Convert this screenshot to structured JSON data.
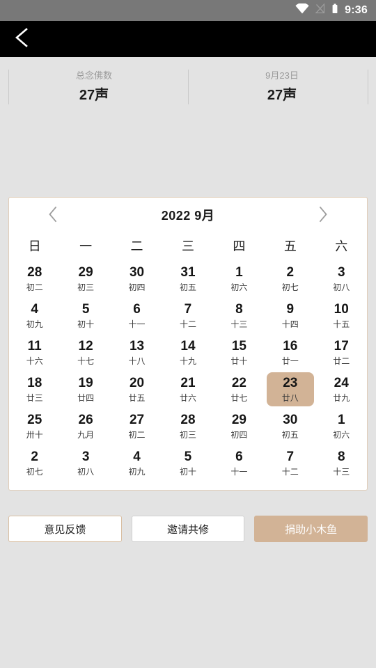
{
  "status_bar": {
    "time": "9:36",
    "icons": [
      "wifi-icon",
      "signal-off-icon",
      "battery-icon"
    ]
  },
  "nav_bar": {
    "back_icon": "back-chevron-icon"
  },
  "stats": [
    {
      "label": "总念佛数",
      "value": "27声"
    },
    {
      "label": "9月23日",
      "value": "27声"
    }
  ],
  "calendar": {
    "title": "2022  9月",
    "prev_icon": "chevron-left-icon",
    "next_icon": "chevron-right-icon",
    "weekdays": [
      "日",
      "一",
      "二",
      "三",
      "四",
      "五",
      "六"
    ],
    "weeks": [
      [
        {
          "num": "28",
          "lunar": "初二",
          "selected": false
        },
        {
          "num": "29",
          "lunar": "初三",
          "selected": false
        },
        {
          "num": "30",
          "lunar": "初四",
          "selected": false
        },
        {
          "num": "31",
          "lunar": "初五",
          "selected": false
        },
        {
          "num": "1",
          "lunar": "初六",
          "selected": false
        },
        {
          "num": "2",
          "lunar": "初七",
          "selected": false
        },
        {
          "num": "3",
          "lunar": "初八",
          "selected": false
        }
      ],
      [
        {
          "num": "4",
          "lunar": "初九",
          "selected": false
        },
        {
          "num": "5",
          "lunar": "初十",
          "selected": false
        },
        {
          "num": "6",
          "lunar": "十一",
          "selected": false
        },
        {
          "num": "7",
          "lunar": "十二",
          "selected": false
        },
        {
          "num": "8",
          "lunar": "十三",
          "selected": false
        },
        {
          "num": "9",
          "lunar": "十四",
          "selected": false
        },
        {
          "num": "10",
          "lunar": "十五",
          "selected": false
        }
      ],
      [
        {
          "num": "11",
          "lunar": "十六",
          "selected": false
        },
        {
          "num": "12",
          "lunar": "十七",
          "selected": false
        },
        {
          "num": "13",
          "lunar": "十八",
          "selected": false
        },
        {
          "num": "14",
          "lunar": "十九",
          "selected": false
        },
        {
          "num": "15",
          "lunar": "廿十",
          "selected": false
        },
        {
          "num": "16",
          "lunar": "廿一",
          "selected": false
        },
        {
          "num": "17",
          "lunar": "廿二",
          "selected": false
        }
      ],
      [
        {
          "num": "18",
          "lunar": "廿三",
          "selected": false
        },
        {
          "num": "19",
          "lunar": "廿四",
          "selected": false
        },
        {
          "num": "20",
          "lunar": "廿五",
          "selected": false
        },
        {
          "num": "21",
          "lunar": "廿六",
          "selected": false
        },
        {
          "num": "22",
          "lunar": "廿七",
          "selected": false
        },
        {
          "num": "23",
          "lunar": "廿八",
          "selected": true
        },
        {
          "num": "24",
          "lunar": "廿九",
          "selected": false
        }
      ],
      [
        {
          "num": "25",
          "lunar": "卅十",
          "selected": false
        },
        {
          "num": "26",
          "lunar": "九月",
          "selected": false
        },
        {
          "num": "27",
          "lunar": "初二",
          "selected": false
        },
        {
          "num": "28",
          "lunar": "初三",
          "selected": false
        },
        {
          "num": "29",
          "lunar": "初四",
          "selected": false
        },
        {
          "num": "30",
          "lunar": "初五",
          "selected": false
        },
        {
          "num": "1",
          "lunar": "初六",
          "selected": false
        }
      ],
      [
        {
          "num": "2",
          "lunar": "初七",
          "selected": false
        },
        {
          "num": "3",
          "lunar": "初八",
          "selected": false
        },
        {
          "num": "4",
          "lunar": "初九",
          "selected": false
        },
        {
          "num": "5",
          "lunar": "初十",
          "selected": false
        },
        {
          "num": "6",
          "lunar": "十一",
          "selected": false
        },
        {
          "num": "7",
          "lunar": "十二",
          "selected": false
        },
        {
          "num": "8",
          "lunar": "十三",
          "selected": false
        }
      ]
    ]
  },
  "actions": [
    {
      "label": "意见反馈",
      "style": "border-tan"
    },
    {
      "label": "邀请共修",
      "style": "border-grey"
    },
    {
      "label": "捐助小木鱼",
      "style": "filled-tan"
    }
  ],
  "colors": {
    "page_background": "#e3e3e3",
    "status_bar": "#787878",
    "nav_bar": "#000000",
    "accent_tan": "#d2b396",
    "card_border": "#e0cdb8",
    "muted_text": "#9a9a9a"
  }
}
